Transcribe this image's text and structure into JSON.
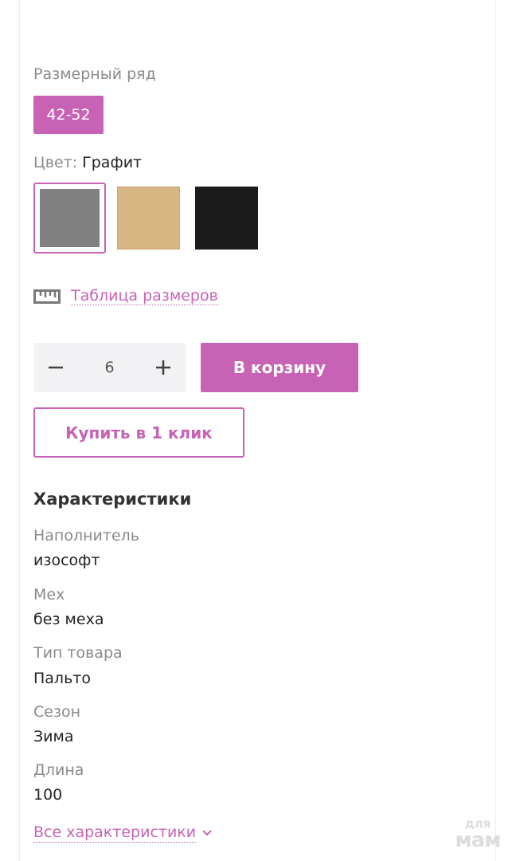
{
  "size_range": {
    "label": "Размерный ряд",
    "selected": "42-52"
  },
  "color": {
    "label": "Цвет:",
    "selected_name": "Графит",
    "swatches": [
      {
        "name": "graphite",
        "hex": "#808080",
        "selected": true
      },
      {
        "name": "beige",
        "hex": "#d6b784",
        "selected": false
      },
      {
        "name": "black",
        "hex": "#1b1b1b",
        "selected": false
      }
    ]
  },
  "size_table": {
    "icon": "ruler-icon",
    "label": "Таблица размеров"
  },
  "quantity": {
    "value": "6",
    "minus_icon": "minus-icon",
    "plus_icon": "plus-icon"
  },
  "actions": {
    "add_to_cart": "В корзину",
    "buy_one_click": "Купить в 1 клик"
  },
  "specs": {
    "title": "Характеристики",
    "items": [
      {
        "name": "Наполнитель",
        "value": "изософт"
      },
      {
        "name": "Мех",
        "value": "без меха"
      },
      {
        "name": "Тип товара",
        "value": "Пальто"
      },
      {
        "name": "Сезон",
        "value": "Зима"
      },
      {
        "name": "Длина",
        "value": "100"
      }
    ],
    "all_link": "Все характеристики"
  },
  "watermark": {
    "line1": "для",
    "line2": "мам"
  },
  "colors": {
    "accent": "#c862b5",
    "muted_text": "#8a8a8a",
    "text": "#222222",
    "qty_bg": "#f2f2f4"
  }
}
